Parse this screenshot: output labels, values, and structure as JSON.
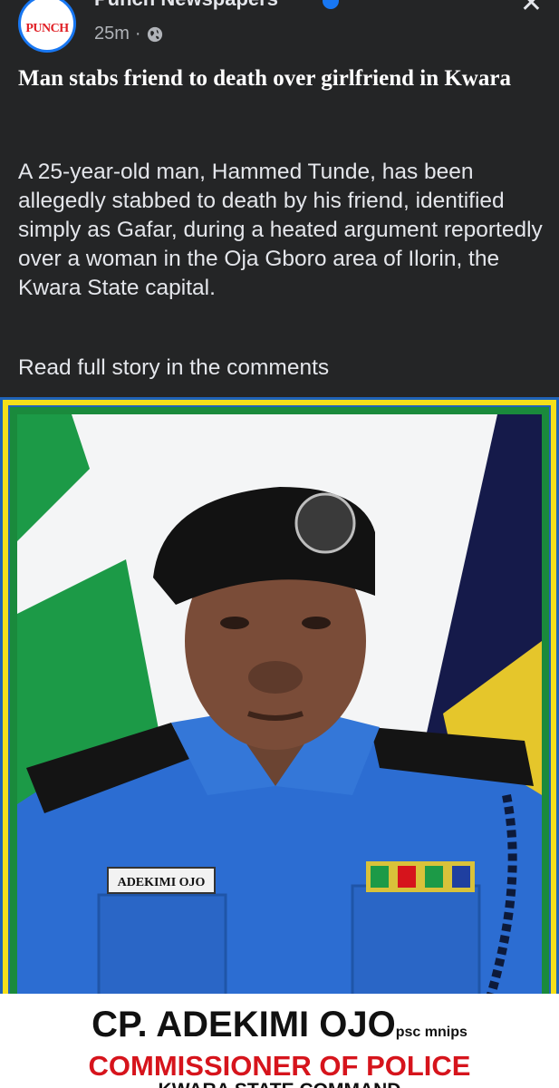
{
  "header": {
    "page_name": "Punch Newspapers",
    "avatar_logo": "PUNCH",
    "timestamp": "25m",
    "separator": "·",
    "icons": [
      "punch-logo-icon",
      "verified-badge-icon",
      "globe-icon",
      "close-icon"
    ],
    "accent_color": "#1877f2"
  },
  "post": {
    "title": "Man stabs friend to death over girlfriend in Kwara",
    "body": "A 25-year-old man, Hammed Tunde, has been allegedly stabbed to death by his friend, identified simply as Gafar, during a heated argument reportedly over a woman in the Oja Gboro area of Ilorin, the Kwara State capital.",
    "read_more": "Read full story in the comments"
  },
  "photo": {
    "name_tag": "ADEKIMI OJO",
    "caption_name": "CP. ADEKIMI OJO",
    "caption_suffix": "psc mnips",
    "caption_role": "COMMISSIONER OF POLICE",
    "caption_command": "KWARA STATE COMMAND",
    "frame_colors": [
      "#f5df1a",
      "#1a8a3c"
    ],
    "role_color": "#d6141c"
  }
}
